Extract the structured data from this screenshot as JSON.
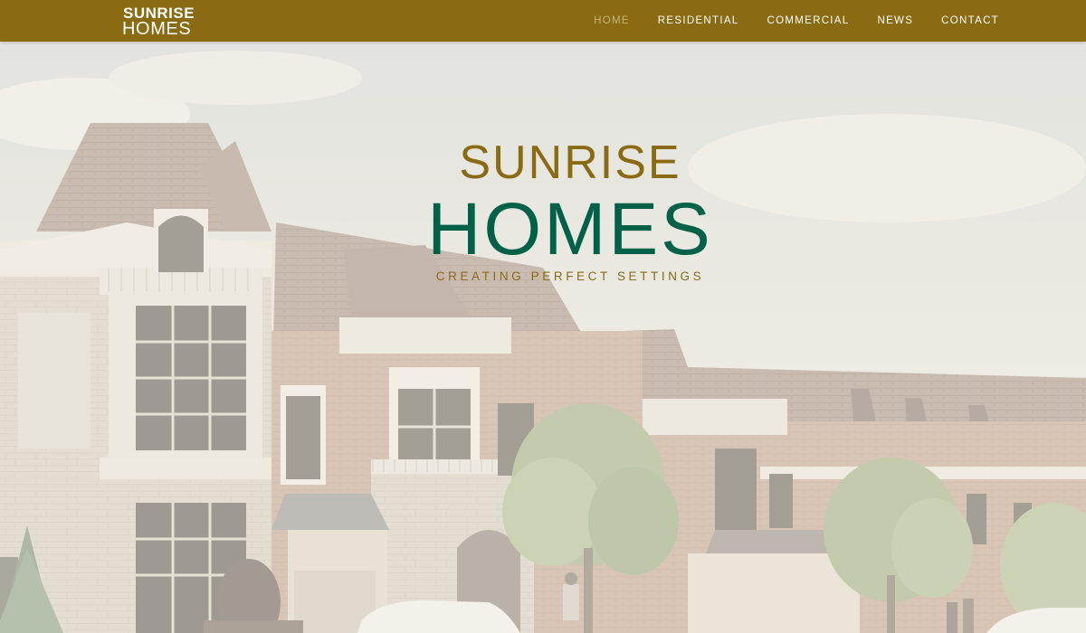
{
  "header": {
    "brand_line1": "SUNRISE",
    "brand_line2": "HOMES",
    "nav": [
      {
        "label": "HOME",
        "active": true
      },
      {
        "label": "RESIDENTIAL",
        "active": false
      },
      {
        "label": "COMMERCIAL",
        "active": false
      },
      {
        "label": "NEWS",
        "active": false
      },
      {
        "label": "CONTACT",
        "active": false
      }
    ]
  },
  "hero": {
    "logo_line1": "SUNRISE",
    "logo_line2": "HOMES",
    "tagline": "CREATING PERFECT SETTINGS"
  },
  "colors": {
    "header_bg": "#8a6b12",
    "nav_active": "#c7b27b",
    "logo_gold": "#8a6b12",
    "logo_green": "#006149"
  }
}
